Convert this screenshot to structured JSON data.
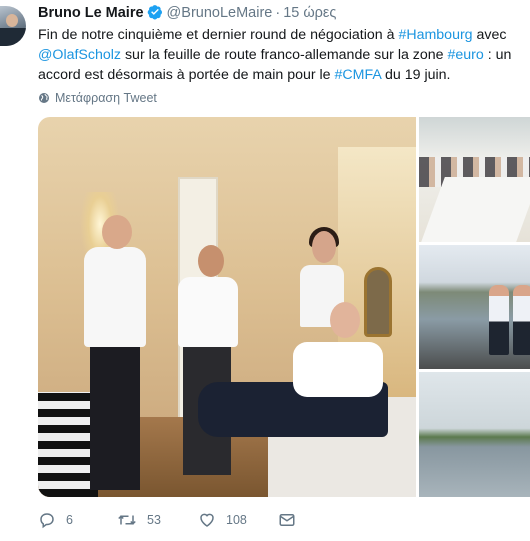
{
  "tweet": {
    "author_name": "Bruno Le Maire",
    "handle": "@BrunoLeMaire",
    "separator": "·",
    "time": "15 ώρες",
    "text_segments": [
      {
        "text": "Fin de notre cinquième et dernier round de négociation à ",
        "link": false
      },
      {
        "text": "#Hambourg",
        "link": true
      },
      {
        "text": " avec ",
        "link": false
      },
      {
        "text": "@OlafScholz",
        "link": true
      },
      {
        "text": " sur la feuille de route franco-allemande sur la zone ",
        "link": false
      },
      {
        "text": "#euro",
        "link": true
      },
      {
        "text": " : un accord est désormais à portée de main pour le ",
        "link": false
      },
      {
        "text": "#CMFA",
        "link": true
      },
      {
        "text": " du 19 juin.",
        "link": false
      }
    ],
    "translate_label": "Μετάφραση Tweet",
    "reply_count": "6",
    "retweet_count": "53",
    "like_count": "108"
  },
  "icons": {
    "verified": "verified-badge-icon",
    "translate": "globe-icon",
    "reply": "reply-icon",
    "retweet": "retweet-icon",
    "like": "heart-icon",
    "dm": "envelope-icon"
  },
  "colors": {
    "link": "#1b95e0",
    "secondary_text": "#657786",
    "primary_text": "#14171a",
    "verified": "#1da1f2"
  }
}
